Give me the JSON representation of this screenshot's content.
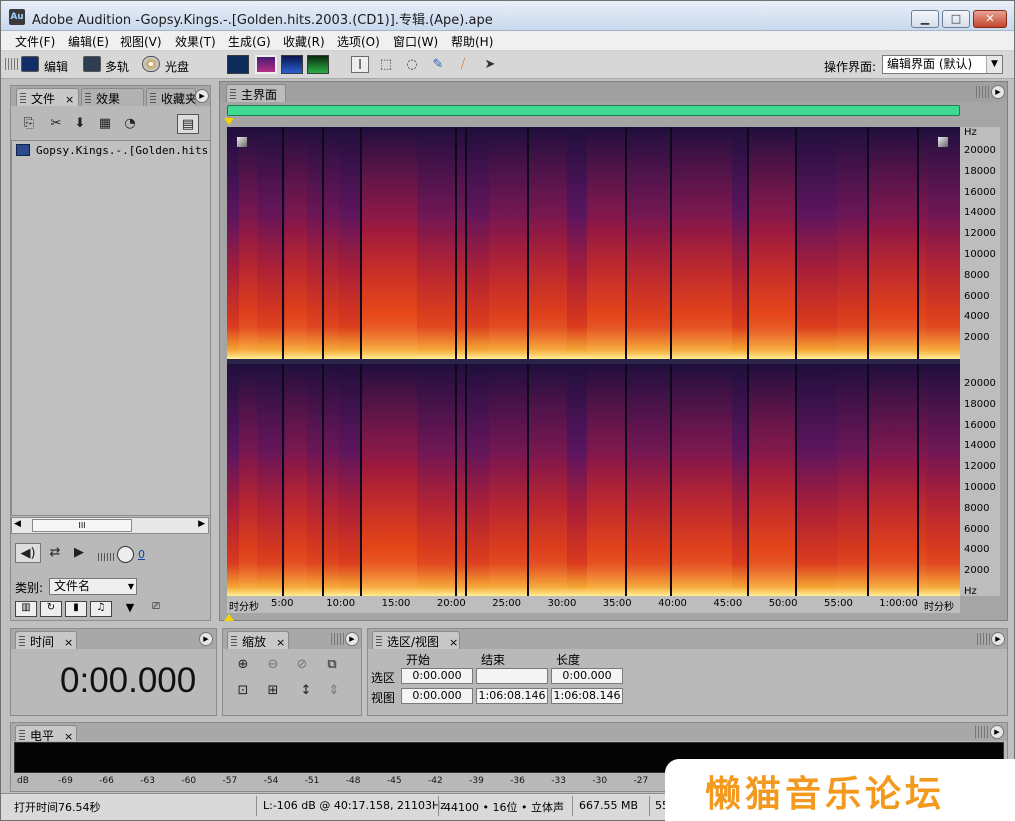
{
  "window": {
    "title": "Adobe Audition -Gopsy.Kings.-.[Golden.hits.2003.(CD1)].专辑.(Ape).ape",
    "app_icon": "Au"
  },
  "menu": [
    "文件(F)",
    "编辑(E)",
    "视图(V)",
    "效果(T)",
    "生成(G)",
    "收藏(R)",
    "选项(O)",
    "窗口(W)",
    "帮助(H)"
  ],
  "toolbar": {
    "edit_label": "编辑",
    "multitrack_label": "多轨",
    "cd_label": "光盘",
    "workspace_label": "操作界面:",
    "workspace_value": "编辑界面 (默认)"
  },
  "files_panel": {
    "tabs": [
      "文件",
      "效果",
      "收藏夹"
    ],
    "file_name": "Gopsy.Kings.-.[Golden.hits",
    "sort_label": "类别:",
    "sort_value": "文件名",
    "scroll_grip": "III",
    "volume_value": "0"
  },
  "editor": {
    "tab": "主界面",
    "freq_unit": "Hz",
    "freq_ticks": [
      "20000",
      "18000",
      "16000",
      "14000",
      "12000",
      "10000",
      "8000",
      "6000",
      "4000",
      "2000"
    ],
    "freq_ticks_ch2": [
      "20000",
      "18000",
      "16000",
      "14000",
      "12000",
      "10000",
      "8000",
      "6000",
      "4000",
      "2000",
      "Hz"
    ],
    "time_unit_left": "时分秒",
    "time_unit_right": "时分秒",
    "time_ticks": [
      "5:00",
      "10:00",
      "15:00",
      "20:00",
      "25:00",
      "30:00",
      "35:00",
      "40:00",
      "45:00",
      "50:00",
      "55:00",
      "1:00:00"
    ]
  },
  "time_panel": {
    "tab": "时间",
    "value": "0:00.000"
  },
  "zoom_panel": {
    "tab": "缩放"
  },
  "selection_panel": {
    "tab": "选区/视图",
    "col_start": "开始",
    "col_end": "结束",
    "col_length": "长度",
    "row_selection": "选区",
    "row_view": "视图",
    "sel_start": "0:00.000",
    "sel_end": "",
    "sel_length": "0:00.000",
    "view_start": "0:00.000",
    "view_end": "1:06:08.146",
    "view_length": "1:06:08.146"
  },
  "level_panel": {
    "tab": "电平",
    "scale": [
      "dB",
      "-69",
      "-66",
      "-63",
      "-60",
      "-57",
      "-54",
      "-51",
      "-48",
      "-45",
      "-42",
      "-39",
      "-36",
      "-33",
      "-30",
      "-27"
    ]
  },
  "status": {
    "open_time": "打开时间76.54秒",
    "cursor": "L:-106 dB @ 40:17.158, 21103Hz",
    "format": "44100 • 16位 • 立体声",
    "size": "667.55 MB",
    "free": "55"
  },
  "watermark": "懒猫音乐论坛",
  "colors": {
    "overview": "#3fd992",
    "accent_watermark": "#f39a1e"
  }
}
